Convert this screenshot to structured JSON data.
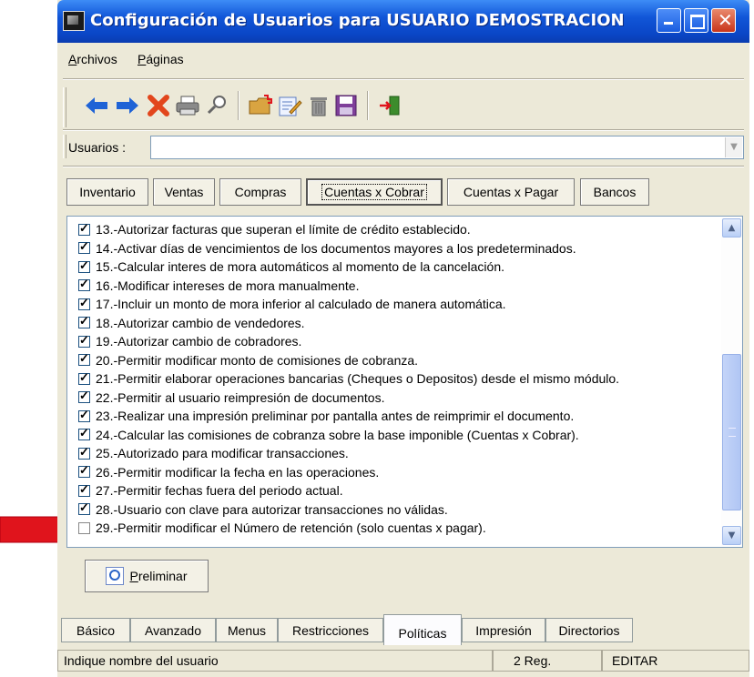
{
  "window": {
    "title": "Configuración de Usuarios para USUARIO DEMOSTRACION"
  },
  "menu": [
    {
      "pre": "",
      "key": "A",
      "rest": "rchivos"
    },
    {
      "pre": "",
      "key": "P",
      "rest": "áginas"
    }
  ],
  "toolbar_icons": [
    "back-arrow-icon",
    "forward-arrow-icon",
    "delete-icon",
    "print-icon",
    "search-icon",
    "new-folder-icon",
    "edit-icon",
    "trash-icon",
    "save-icon",
    "exit-icon"
  ],
  "users": {
    "label": "Usuarios :",
    "value": ""
  },
  "top_tabs": [
    "Inventario",
    "Ventas",
    "Compras",
    "Cuentas x Cobrar",
    "Cuentas x Pagar",
    "Bancos"
  ],
  "active_top_tab": "Cuentas x Cobrar",
  "permissions": [
    {
      "text": "13.-Autorizar facturas que superan el límite de crédito establecido.",
      "checked": true
    },
    {
      "text": "14.-Activar días de vencimientos de los documentos mayores a los predeterminados.",
      "checked": true
    },
    {
      "text": "15.-Calcular interes de mora automáticos al momento de la cancelación.",
      "checked": true
    },
    {
      "text": "16.-Modificar intereses de mora manualmente.",
      "checked": true
    },
    {
      "text": "17.-Incluir un monto de mora inferior al calculado de manera automática.",
      "checked": true
    },
    {
      "text": "18.-Autorizar cambio de vendedores.",
      "checked": true
    },
    {
      "text": "19.-Autorizar cambio de cobradores.",
      "checked": true
    },
    {
      "text": "20.-Permitir modificar monto de comisiones de cobranza.",
      "checked": true
    },
    {
      "text": "21.-Permitir elaborar operaciones bancarias (Cheques o Depositos) desde el mismo módulo.",
      "checked": true
    },
    {
      "text": "22.-Permitir al usuario reimpresión de documentos.",
      "checked": true
    },
    {
      "text": "23.-Realizar una impresión preliminar por pantalla antes de reimprimir el documento.",
      "checked": true
    },
    {
      "text": "24.-Calcular las comisiones de cobranza sobre la base imponible (Cuentas x Cobrar).",
      "checked": true
    },
    {
      "text": "25.-Autorizado para modificar transacciones.",
      "checked": true
    },
    {
      "text": "26.-Permitir modificar la fecha en las operaciones.",
      "checked": true
    },
    {
      "text": "27.-Permitir fechas fuera del periodo actual.",
      "checked": true
    },
    {
      "text": "28.-Usuario con clave para autorizar transacciones no válidas.",
      "checked": true
    },
    {
      "text": "29.-Permitir modificar el Número de retención (solo cuentas x pagar).",
      "checked": false
    }
  ],
  "preliminar": {
    "key": "P",
    "rest": "reliminar"
  },
  "bottom_tabs": [
    "Básico",
    "Avanzado",
    "Menus",
    "Restricciones",
    "Políticas",
    "Impresión",
    "Directorios"
  ],
  "active_bottom_tab": "Políticas",
  "status": {
    "message": "Indique nombre del usuario",
    "records": "2 Reg.",
    "mode": "EDITAR"
  },
  "colors": {
    "title_bar": "#0a46c6",
    "window_bg": "#ece9d8",
    "red_arrow": "#e0141c"
  }
}
